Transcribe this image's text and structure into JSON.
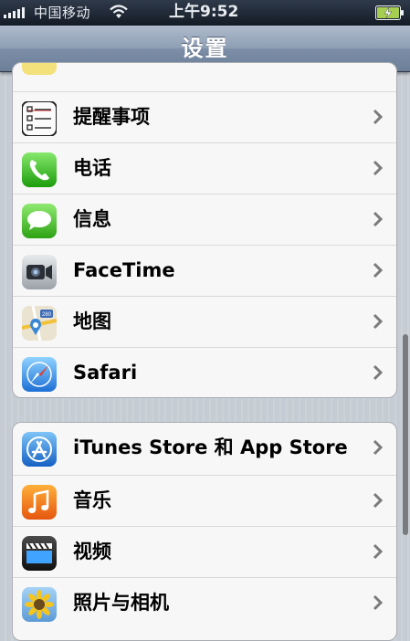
{
  "status_bar": {
    "carrier": "中国移动",
    "time": "上午9:52"
  },
  "nav": {
    "title": "设置"
  },
  "groups": [
    {
      "rows": [
        {
          "label": "提醒事项",
          "icon": "reminders-icon"
        },
        {
          "label": "电话",
          "icon": "phone-icon"
        },
        {
          "label": "信息",
          "icon": "messages-icon"
        },
        {
          "label": "FaceTime",
          "icon": "facetime-icon"
        },
        {
          "label": "地图",
          "icon": "maps-icon"
        },
        {
          "label": "Safari",
          "icon": "safari-icon"
        }
      ]
    },
    {
      "rows": [
        {
          "label": "iTunes Store 和 App Store",
          "icon": "app-store-icon"
        },
        {
          "label": "音乐",
          "icon": "music-icon"
        },
        {
          "label": "视频",
          "icon": "videos-icon"
        },
        {
          "label": "照片与相机",
          "icon": "photos-icon"
        }
      ]
    }
  ],
  "colors": {
    "nav_bar": "#8d9db3",
    "background": "#c5ccd4",
    "group_fill": "#f7f7f7"
  }
}
